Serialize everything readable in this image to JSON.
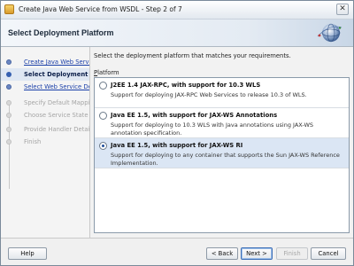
{
  "window": {
    "title": "Create Java Web Service from WSDL - Step 2 of 7",
    "close_glyph": "✕",
    "app_icon": "wizard-icon"
  },
  "header": {
    "title": "Select Deployment Platform",
    "graphic": "globe-icon"
  },
  "sidebar": {
    "steps": [
      {
        "label": "Create Java Web Service",
        "state": "done"
      },
      {
        "label": "Select Deployment Platform",
        "state": "current"
      },
      {
        "label": "Select Web Service Description",
        "state": "done"
      },
      {
        "label": "Specify Default Mapping Options",
        "state": "pending"
      },
      {
        "label": "Choose Service State",
        "state": "pending"
      },
      {
        "label": "Provide Handler Details",
        "state": "pending"
      },
      {
        "label": "Finish",
        "state": "pending"
      }
    ]
  },
  "main": {
    "instruction": "Select the deployment platform that matches your requirements.",
    "platform_label_mnemonic": "P",
    "platform_label_rest": "latform",
    "options": [
      {
        "title": "J2EE 1.4 JAX-RPC, with support for 10.3 WLS",
        "description": "Support for deploying JAX-RPC Web Services to release 10.3 of WLS.",
        "selected": false
      },
      {
        "title": "Java EE 1.5, with support for JAX-WS Annotations",
        "description": "Support for deploying to 10.3 WLS with Java annotations using JAX-WS annotation specification.",
        "selected": false
      },
      {
        "title": "Java EE 1.5, with support for JAX-WS RI",
        "description": "Support for deploying to any container that supports the Sun JAX-WS Reference Implementation.",
        "selected": true
      }
    ]
  },
  "footer": {
    "help_label": "Help",
    "back_label": "< Back",
    "next_label": "Next >",
    "finish_label": "Finish",
    "cancel_label": "Cancel"
  },
  "colors": {
    "accent": "#3660b0",
    "selected_row": "#dbe6f4",
    "link": "#1a3fa8"
  }
}
